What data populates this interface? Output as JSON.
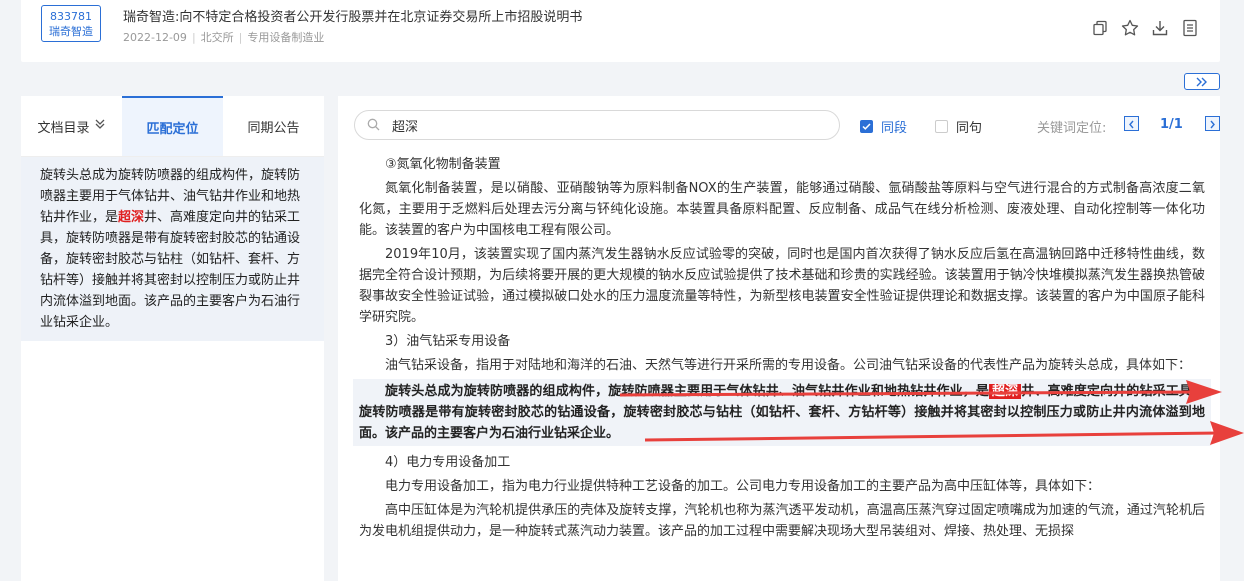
{
  "header": {
    "code": "833781",
    "short_name": "瑞奇智造",
    "title": "瑞奇智造:向不特定合格投资者公开发行股票并在北京证券交易所上市招股说明书",
    "date": "2022-12-09",
    "exchange": "北交所",
    "industry": "专用设备制造业",
    "icons": [
      "copy-icon",
      "star-icon",
      "download-icon",
      "document-icon"
    ]
  },
  "left": {
    "tabs": [
      {
        "label": "文档目录"
      },
      {
        "label": "匹配定位"
      },
      {
        "label": "同期公告"
      }
    ],
    "match_text_before": "旋转头总成为旋转防喷器的组成构件，旋转防喷器主要用于气体钻井、油气钻井作业和地热钻井作业，是",
    "match_keyword": "超深",
    "match_text_after": "井、高难度定向井的钻采工具，旋转防喷器是带有旋转密封胶芯的钻通设备，旋转密封胶芯与钻柱（如钻杆、套杆、方钻杆等）接触并将其密封以控制压力或防止井内流体溢到地面。该产品的主要客户为石油行业钻采企业。"
  },
  "search": {
    "value": "超深",
    "opt_same_paragraph": "同段",
    "opt_same_sentence": "同句",
    "keyword_locate_label": "关键词定位:",
    "page_indicator": "1/1"
  },
  "content": {
    "h1": "③氮氧化物制备装置",
    "p1": "氮氧化制备装置，是以硝酸、亚硝酸钠等为原料制备NOX的生产装置，能够通过硝酸、氩硝酸盐等原料与空气进行混合的方式制备高浓度二氧化氮，主要用于乏燃料后处理去污分离与钚纯化设施。本装置具备原料配置、反应制备、成品气在线分析检测、废液处理、自动化控制等一体化功能。该装置的客户为中国核电工程有限公司。",
    "p2": "2019年10月，该装置实现了国内蒸汽发生器钠水反应试验零的突破，同时也是国内首次获得了钠水反应后氢在高温钠回路中迁移特性曲线，数据完全符合设计预期，为后续将要开展的更大规模的钠水反应试验提供了技术基础和珍贵的实践经验。该装置用于钠冷快堆模拟蒸汽发生器换热管破裂事故安全性验证试验，通过模拟破口处水的压力温度流量等特性，为新型核电装置安全性验证提供理论和数据支撑。该装置的客户为中国原子能科学研究院。",
    "h2": "3）油气钻采专用设备",
    "p3": "油气钻采设备，指用于对陆地和海洋的石油、天然气等进行开采所需的专用设备。公司油气钻采设备的代表性产品为旋转头总成，具体如下：",
    "hit_before": "旋转头总成为旋转防喷器的组成构件，旋转防喷器主要用于气体钻井、油气钻井作业和地热钻井作业，是",
    "hit_keyword": "超深",
    "hit_after": "井、高难度定向井的钻采工具，旋转防喷器是带有旋转密封胶芯的钻通设备，旋转密封胶芯与钻柱（如钻杆、套杆、方钻杆等）接触并将其密封以控制压力或防止井内流体溢到地面。该产品的主要客户为石油行业钻采企业。",
    "h3": "4）电力专用设备加工",
    "p4": "电力专用设备加工，指为电力行业提供特种工艺设备的加工。公司电力专用设备加工的主要产品为高中压缸体等，具体如下：",
    "p5": "高中压缸体是为汽轮机提供承压的壳体及旋转支撑，汽轮机也称为蒸汽透平发动机，高温高压蒸汽穿过固定喷嘴成为加速的气流，通过汽轮机后为发电机组提供动力，是一种旋转式蒸汽动力装置。该产品的加工过程中需要解决现场大型吊装组对、焊接、热处理、无损探"
  },
  "colors": {
    "accent": "#2b6fd6",
    "highlight": "#e02020",
    "arrow": "#e8403c"
  }
}
